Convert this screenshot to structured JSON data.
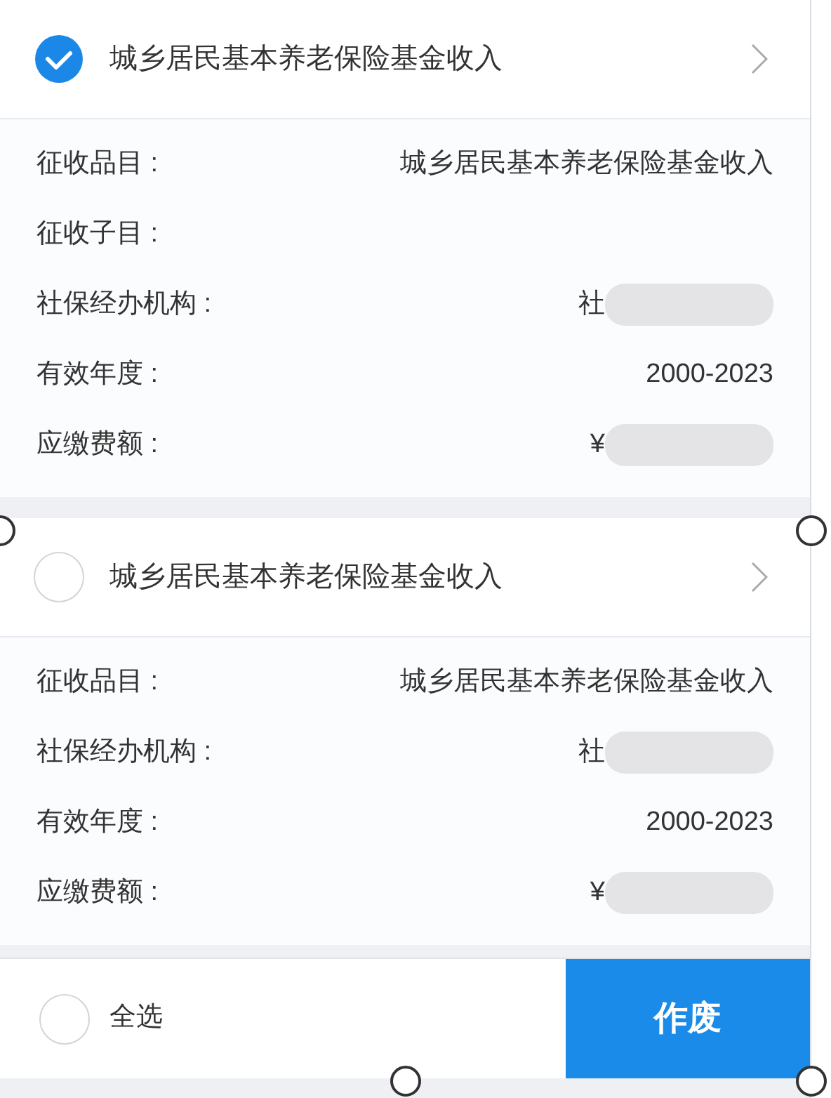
{
  "records": [
    {
      "selected": true,
      "title": "城乡居民基本养老保险基金收入",
      "fields": [
        {
          "label": "征收品目 :",
          "value": "城乡居民基本养老保险基金收入",
          "blurred": false
        },
        {
          "label": "征收子目 :",
          "blurred": false
        },
        {
          "label": "社保经办机构 :",
          "value": "社",
          "blurred": true
        },
        {
          "label": "有效年度 :",
          "value": "2000-2023",
          "blurred": false
        },
        {
          "label": "应缴费额 :",
          "value": "¥",
          "blurred": true
        }
      ]
    },
    {
      "selected": false,
      "title": "城乡居民基本养老保险基金收入",
      "fields": [
        {
          "label": "征收品目 :",
          "value": "城乡居民基本养老保险基金收入",
          "blurred": false
        },
        {
          "label": "社保经办机构 :",
          "value": "社",
          "blurred": true
        },
        {
          "label": "有效年度 :",
          "value": "2000-2023",
          "blurred": false
        },
        {
          "label": "应缴费额 :",
          "value": "¥",
          "blurred": true
        }
      ]
    }
  ],
  "footer": {
    "select_all": {
      "label": "全选",
      "selected": false
    },
    "action": "作废"
  }
}
